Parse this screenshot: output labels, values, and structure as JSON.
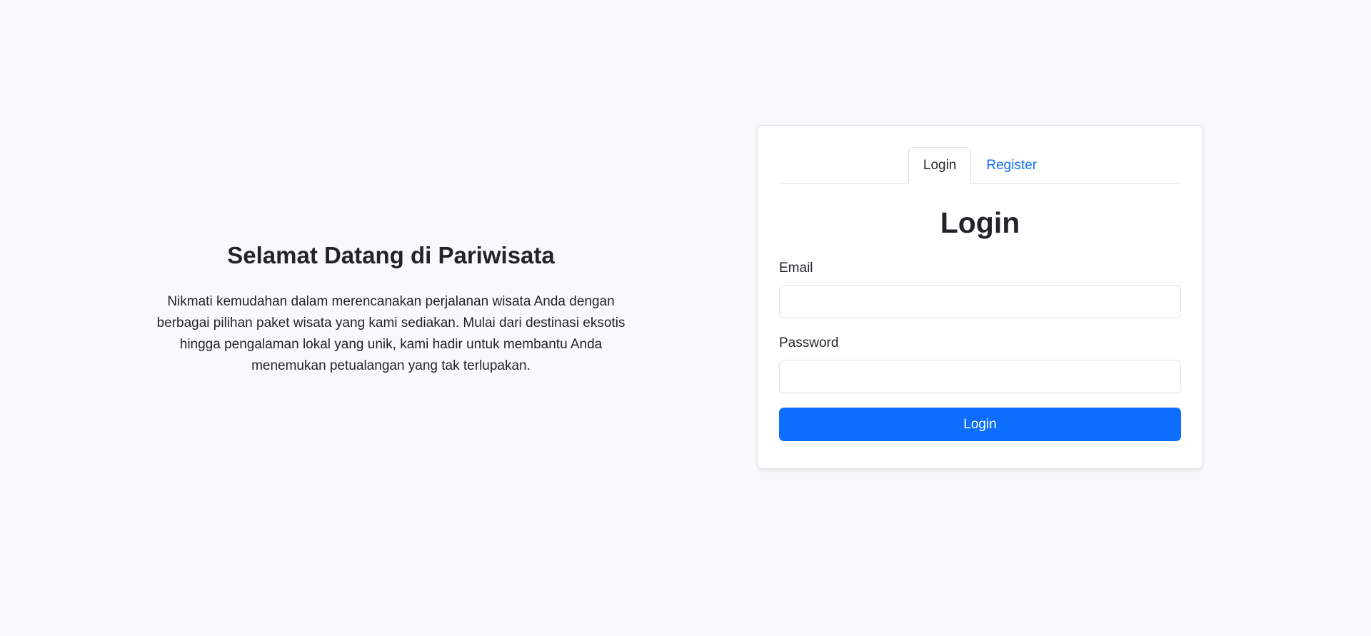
{
  "welcome": {
    "title": "Selamat Datang di Pariwisata",
    "description": "Nikmati kemudahan dalam merencanakan perjalanan wisata Anda dengan berbagai pilihan paket wisata yang kami sediakan. Mulai dari destinasi eksotis hingga pengalaman lokal yang unik, kami hadir untuk membantu Anda menemukan petualangan yang tak terlupakan."
  },
  "auth_card": {
    "tabs": [
      {
        "label": "Login",
        "active": true
      },
      {
        "label": "Register",
        "active": false
      }
    ],
    "title": "Login",
    "email": {
      "label": "Email",
      "value": "",
      "placeholder": ""
    },
    "password": {
      "label": "Password",
      "value": "",
      "placeholder": ""
    },
    "submit_label": "Login"
  },
  "colors": {
    "background": "#f8f9fa",
    "primary": "#0d6efd",
    "text": "#212529",
    "border": "#dee2e6"
  }
}
